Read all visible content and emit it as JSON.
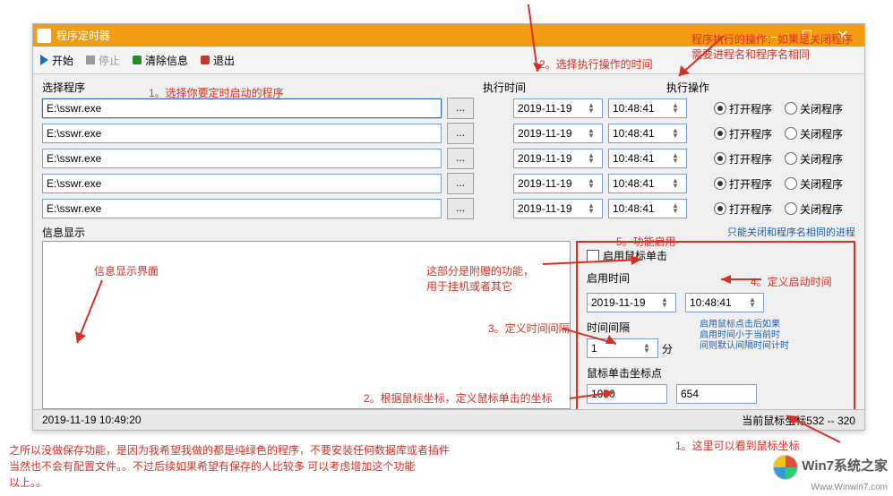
{
  "window": {
    "title": "程序定时器"
  },
  "toolbar": {
    "start": "开始",
    "stop": "停止",
    "clear": "清除信息",
    "exit": "退出"
  },
  "headers": {
    "prog": "选择程序",
    "time": "执行时间",
    "op": "执行操作"
  },
  "rows": [
    {
      "path": "E:\\sswr.exe",
      "date": "2019-11-19",
      "time": "10:48:41",
      "open": "打开程序",
      "close": "关闭程序",
      "sel": true
    },
    {
      "path": "E:\\sswr.exe",
      "date": "2019-11-19",
      "time": "10:48:41",
      "open": "打开程序",
      "close": "关闭程序"
    },
    {
      "path": "E:\\sswr.exe",
      "date": "2019-11-19",
      "time": "10:48:41",
      "open": "打开程序",
      "close": "关闭程序"
    },
    {
      "path": "E:\\sswr.exe",
      "date": "2019-11-19",
      "time": "10:48:41",
      "open": "打开程序",
      "close": "关闭程序"
    },
    {
      "path": "E:\\sswr.exe",
      "date": "2019-11-19",
      "time": "10:48:41",
      "open": "打开程序",
      "close": "关闭程序"
    }
  ],
  "browse": "...",
  "info": {
    "label": "信息显示"
  },
  "noteblue": "只能关闭和程序名相同的进程",
  "panel": {
    "enable": "启用鼠标单击",
    "enable_time": "启用时间",
    "date": "2019-11-19",
    "time": "10:48:41",
    "interval_label": "时间间隔",
    "interval": "1",
    "interval_unit": "分",
    "hint1": "启用鼠标点击后如果",
    "hint2": "启用时间小于当前时",
    "hint3": "间则默认间隔时间计时",
    "coord_label": "鼠标单击坐标点",
    "cx": "1080",
    "cy": "654"
  },
  "status": {
    "time": "2019-11-19 10:49:20",
    "coord": "当前鼠标坐标532 -- 320"
  },
  "anno": {
    "a1": "1。选择你要定时启动的程序",
    "a2": "2。选择执行操作的时间",
    "a3": "程序执行的操作：如果是关闭程序",
    "a3b": "需要进程名和程序名相同",
    "a5": "5。功能启用",
    "a4": "4。定义启动时间",
    "a_interval": "3。定义时间间隔",
    "a_infoui": "信息显示界面",
    "a_bonus1": "这部分是附赠的功能，",
    "a_bonus2": "用于挂机或者其它",
    "a_coord": "2。根据鼠标坐标，定义鼠标单击的坐标",
    "a_here": "1。这里可以看到鼠标坐标",
    "f1": "之所以没做保存功能，是因为我希望我做的都是纯绿色的程序，不要安装任何数据库或者插件",
    "f2": "当然也不会有配置文件。。不过后续如果希望有保存的人比较多 可以考虑增加这个功能",
    "f3": "以上。。"
  },
  "wm": {
    "brand": "Win7系统之家",
    "url": "Www.Winwin7.com"
  }
}
